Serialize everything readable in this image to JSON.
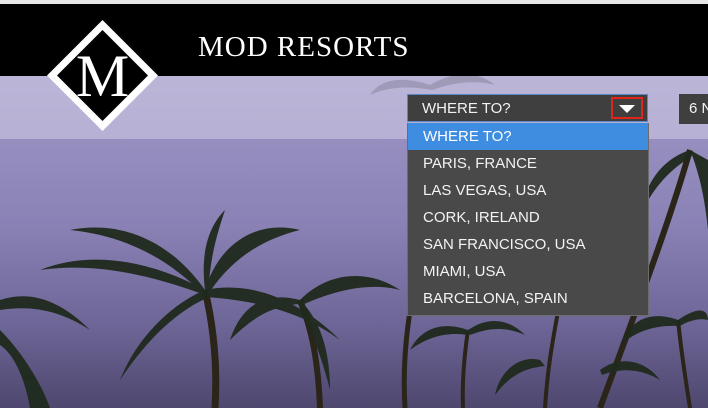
{
  "header": {
    "brand": "MOD RESORTS",
    "logo_letter": "M"
  },
  "search": {
    "destination": {
      "selected_value": "WHERE TO?",
      "options": [
        "WHERE TO?",
        "PARIS, FRANCE",
        "LAS VEGAS, USA",
        "CORK, IRELAND",
        "SAN FRANCISCO, USA",
        "MIAMI, USA",
        "BARCELONA, SPAIN"
      ],
      "highlighted_index": 0
    },
    "guests": {
      "value": "6 N"
    }
  },
  "icons": {
    "dropdown_arrow": "caret-down-icon",
    "logo": "diamond-logo-icon"
  },
  "colors": {
    "header_bg": "#000000",
    "select_bg": "#3f3f3f",
    "dropdown_bg": "#494949",
    "highlight": "#3e8de0",
    "arrow_outline": "#e0261c"
  }
}
